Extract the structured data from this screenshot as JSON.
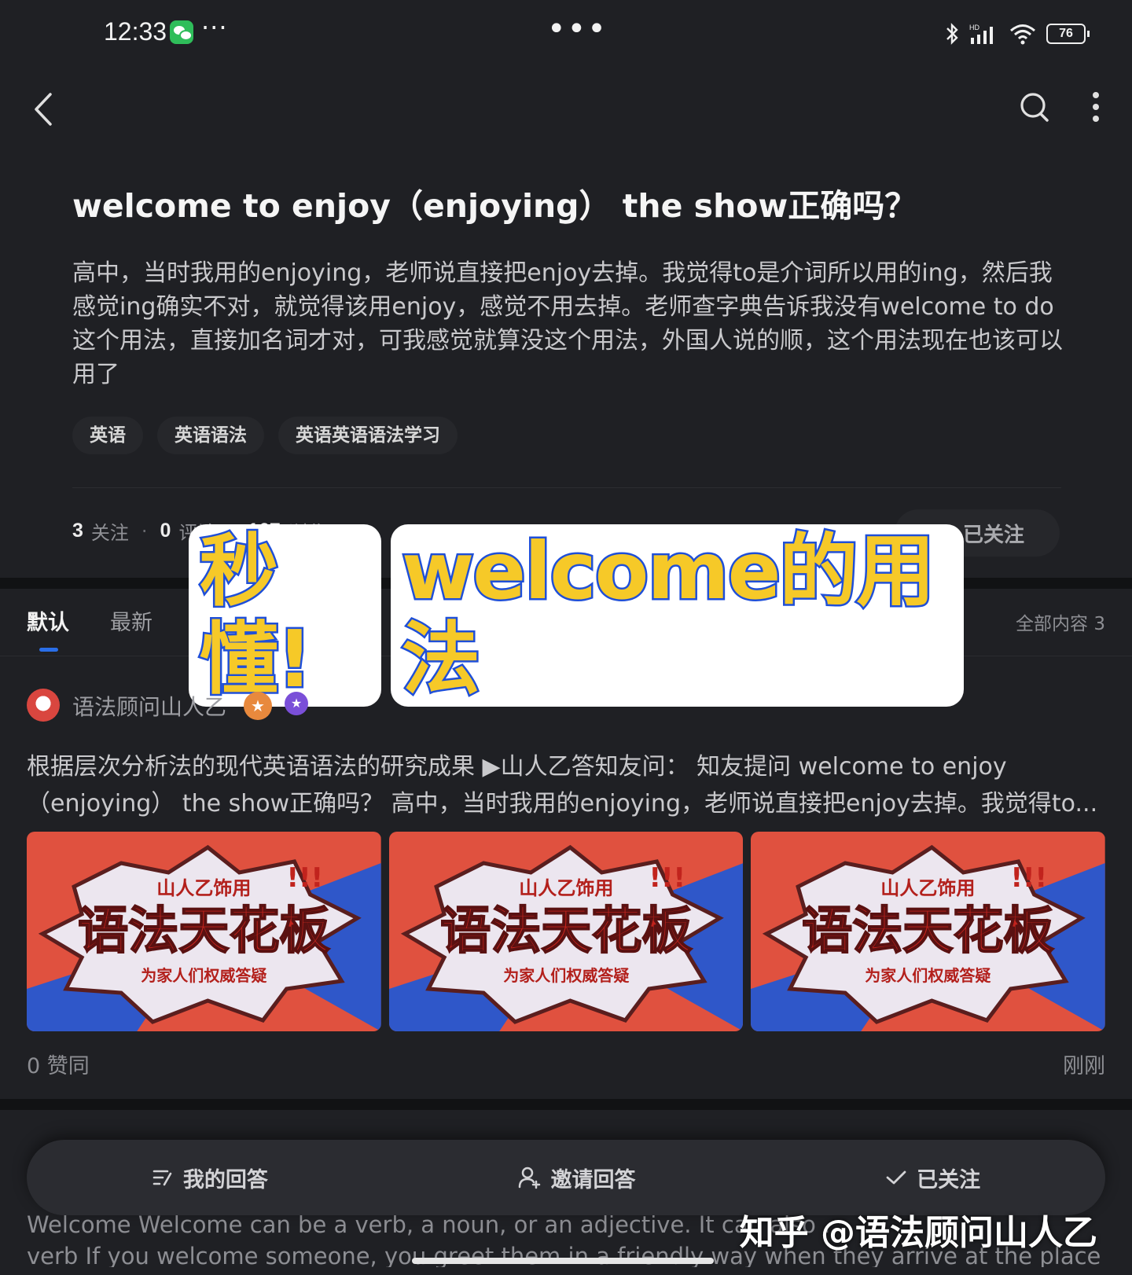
{
  "status_bar": {
    "time": "12:33",
    "notif_dots": "···",
    "center_dots": "•••",
    "battery": "76"
  },
  "question": {
    "title": "welcome to enjoy（enjoying） the show正确吗？",
    "body": "高中，当时我用的enjoying，老师说直接把enjoy去掉。我觉得to是介词所以用的ing，然后我感觉ing确实不对，就觉得该用enjoy，感觉不用去掉。老师查字典告诉我没有welcome to do这个用法，直接加名词才对，可我感觉就算没这个用法，外国人说的顺，这个用法现在也该可以用了",
    "tags": [
      "英语",
      "英语语法",
      "英语英语语法学习"
    ]
  },
  "stats": {
    "follow_count": "3",
    "follow_label": "关注",
    "comment_count": "0",
    "comment_label": "评论",
    "view_count": "167",
    "view_label": "浏览",
    "followed_button": "已关注"
  },
  "tabs": {
    "default": "默认",
    "latest": "最新",
    "all_content": "全部内容 3"
  },
  "overlay": {
    "part1": "秒懂!",
    "part2": "welcome的用法"
  },
  "answer": {
    "author": "语法顾问山人乙",
    "excerpt": "根据层次分析法的现代英语语法的研究成果 ▶山人乙答知友问： 知友提问 welcome to enjoy（enjoying） the show正确吗？ 高中，当时我用的enjoying，老师说直接把enjoy去掉。我觉得to...",
    "image_banner": {
      "top": "山人乙饰用",
      "main": "语法天花板",
      "bottom": "为家人们权威答疑",
      "exclaim": "!!!"
    },
    "votes": "0 赞同",
    "time": "刚刚"
  },
  "bottom_bar": {
    "my_answer": "我的回答",
    "invite": "邀请回答",
    "followed": "已关注"
  },
  "behind_text": {
    "line1": "Welcome Welcome can be a verb, a noun, or an adjective. It can also ...",
    "line2": "verb If you welcome someone, you greet them in a friendly way when they arrive at the place"
  },
  "watermark": "知乎 @语法顾问山人乙",
  "colors": {
    "background": "#1f2024",
    "accent_blue": "#2a6ee8",
    "overlay_yellow": "#f6c928",
    "overlay_stroke": "#1f4fd8"
  }
}
